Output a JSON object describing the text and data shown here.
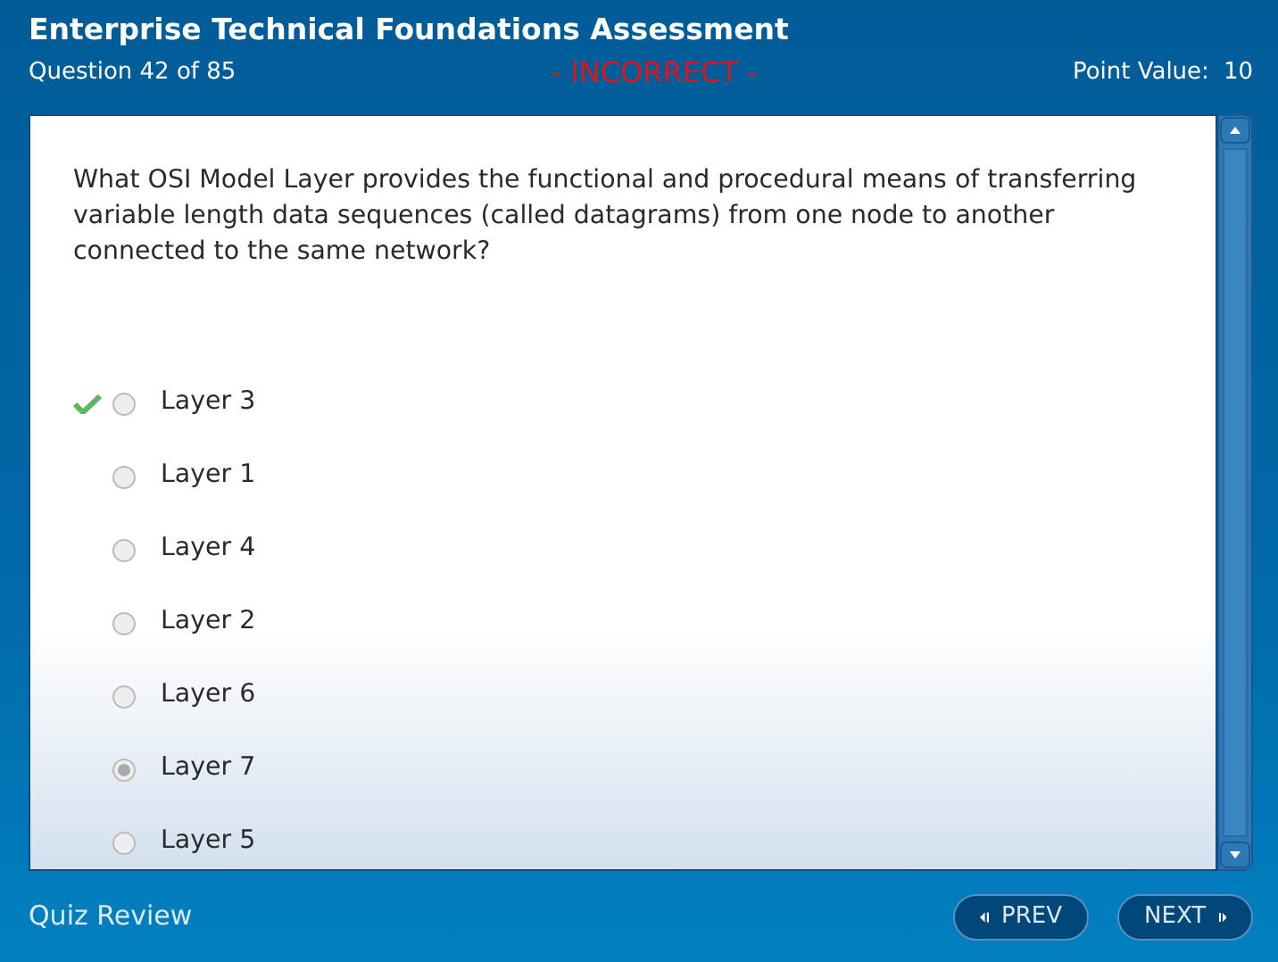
{
  "title": "Enterprise Technical Foundations Assessment",
  "question_counter": "Question 42 of 85",
  "result": "- INCORRECT -",
  "point_value_label": "Point Value:",
  "point_value": "10",
  "question": "What OSI Model Layer provides the functional and procedural means of transferring variable length data sequences (called datagrams) from one node to another connected to the same network?",
  "options": [
    {
      "label": "Layer 3",
      "selected": false,
      "correct": true
    },
    {
      "label": "Layer 1",
      "selected": false,
      "correct": false
    },
    {
      "label": "Layer 4",
      "selected": false,
      "correct": false
    },
    {
      "label": "Layer 2",
      "selected": false,
      "correct": false
    },
    {
      "label": "Layer 6",
      "selected": false,
      "correct": false
    },
    {
      "label": "Layer 7",
      "selected": true,
      "correct": false
    },
    {
      "label": "Layer 5",
      "selected": false,
      "correct": false
    }
  ],
  "footer_label": "Quiz Review",
  "buttons": [
    {
      "label": "PREV",
      "kind": "prev"
    },
    {
      "label": "NEXT",
      "kind": "next"
    }
  ]
}
